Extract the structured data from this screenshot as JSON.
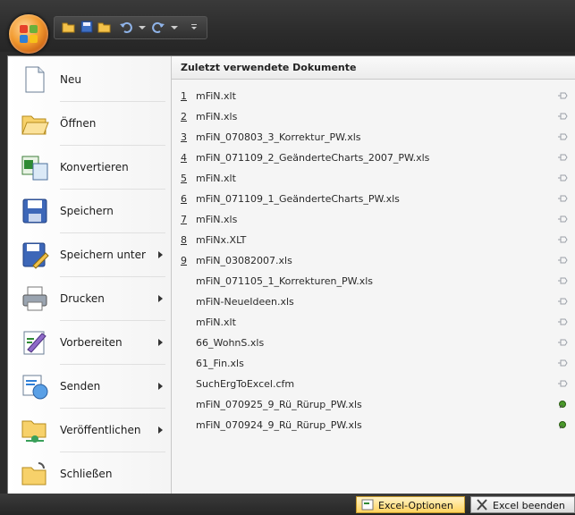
{
  "title_bar": {
    "quick_access_icons": [
      "open-folder-icon",
      "save-icon",
      "folder-icon",
      "undo-icon",
      "redo-icon",
      "customize-icon"
    ]
  },
  "menu_commands": [
    {
      "label": "Neu",
      "icon": "new-document-icon",
      "submenu": false
    },
    {
      "label": "Öffnen",
      "icon": "open-folder-icon",
      "submenu": false
    },
    {
      "label": "Konvertieren",
      "icon": "convert-icon",
      "submenu": false
    },
    {
      "label": "Speichern",
      "icon": "save-icon",
      "submenu": false
    },
    {
      "label": "Speichern unter",
      "icon": "save-as-icon",
      "submenu": true
    },
    {
      "label": "Drucken",
      "icon": "print-icon",
      "submenu": true
    },
    {
      "label": "Vorbereiten",
      "icon": "prepare-icon",
      "submenu": true
    },
    {
      "label": "Senden",
      "icon": "send-icon",
      "submenu": true
    },
    {
      "label": "Veröffentlichen",
      "icon": "publish-icon",
      "submenu": true
    },
    {
      "label": "Schließen",
      "icon": "close-folder-icon",
      "submenu": false
    }
  ],
  "recent": {
    "header": "Zuletzt verwendete Dokumente",
    "items": [
      {
        "num": "1",
        "name": "mFiN.xlt",
        "pinned": false
      },
      {
        "num": "2",
        "name": "mFiN.xls",
        "pinned": false
      },
      {
        "num": "3",
        "name": "mFiN_070803_3_Korrektur_PW.xls",
        "pinned": false
      },
      {
        "num": "4",
        "name": "mFiN_071109_2_GeänderteCharts_2007_PW.xls",
        "pinned": false
      },
      {
        "num": "5",
        "name": "mFiN.xlt",
        "pinned": false
      },
      {
        "num": "6",
        "name": "mFiN_071109_1_GeänderteCharts_PW.xls",
        "pinned": false
      },
      {
        "num": "7",
        "name": "mFiN.xls",
        "pinned": false
      },
      {
        "num": "8",
        "name": "mFiNx.XLT",
        "pinned": false
      },
      {
        "num": "9",
        "name": "mFiN_03082007.xls",
        "pinned": false
      },
      {
        "num": "",
        "name": "mFiN_071105_1_Korrekturen_PW.xls",
        "pinned": false
      },
      {
        "num": "",
        "name": "mFiN-NeueIdeen.xls",
        "pinned": false
      },
      {
        "num": "",
        "name": "mFiN.xlt",
        "pinned": false
      },
      {
        "num": "",
        "name": "66_WohnS.xls",
        "pinned": false
      },
      {
        "num": "",
        "name": "61_Fin.xls",
        "pinned": false
      },
      {
        "num": "",
        "name": "SuchErgToExcel.cfm",
        "pinned": false
      },
      {
        "num": "",
        "name": "mFiN_070925_9_Rü_Rürup_PW.xls",
        "pinned": true
      },
      {
        "num": "",
        "name": "mFiN_070924_9_Rü_Rürup_PW.xls",
        "pinned": true
      }
    ]
  },
  "bottom": {
    "options_label": "Excel-Optionen",
    "exit_label": "Excel beenden"
  },
  "colors": {
    "accent": "#f29a2e",
    "options_button": "#ffd35e",
    "pin_active": "#4a9a2a"
  }
}
